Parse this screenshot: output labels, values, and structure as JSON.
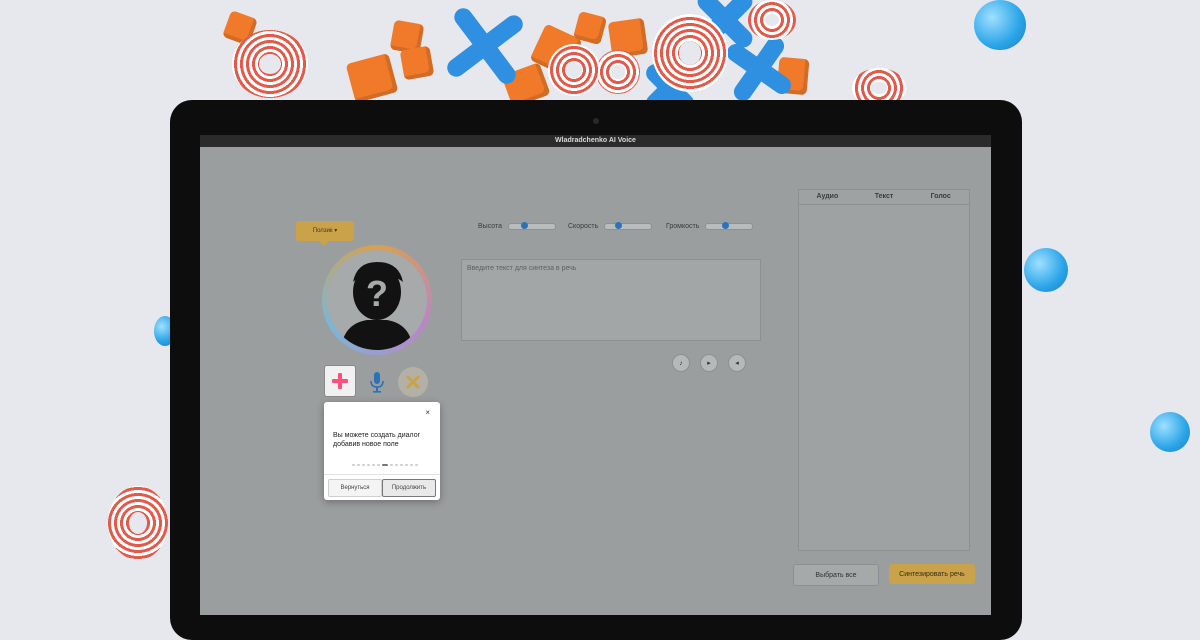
{
  "window": {
    "title": "Wladradchenko AI Voice"
  },
  "speaker": {
    "label": "Ползик"
  },
  "sliders": [
    {
      "label": "Высота",
      "value": 0.35
    },
    {
      "label": "Скорость",
      "value": 0.3
    },
    {
      "label": "Громкость",
      "value": 0.45
    }
  ],
  "text_input": {
    "placeholder": "Введите текст для синтеза в речь"
  },
  "table": {
    "columns": [
      "Аудио",
      "Текст",
      "Голос"
    ]
  },
  "buttons": {
    "select_all": "Выбрать все",
    "synthesize": "Синтезировать речь"
  },
  "popup": {
    "close": "×",
    "message": "Вы можете создать диалог добавив новое поле",
    "back": "Вернуться",
    "next": "Продолжить",
    "steps_total": 13,
    "current_step": 6
  },
  "colors": {
    "accent": "#c9a24a",
    "add_icon": "#ff4f7b",
    "mic_icon": "#2b72b8"
  },
  "icons": [
    "plus-icon",
    "mic-icon",
    "cross-icon",
    "music-icon",
    "play-icon",
    "volume-icon"
  ]
}
